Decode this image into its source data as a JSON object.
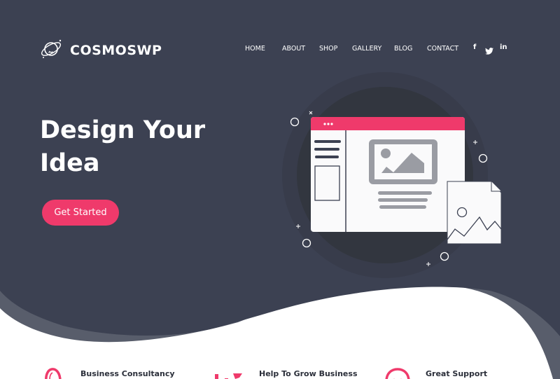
{
  "brand": {
    "name": "COSMOSWP",
    "logo_icon": "planet-icon"
  },
  "nav": {
    "items": [
      {
        "label": "HOME"
      },
      {
        "label": "ABOUT"
      },
      {
        "label": "SHOP"
      },
      {
        "label": "GALLERY"
      },
      {
        "label": "BLOG"
      },
      {
        "label": "CONTACT"
      }
    ],
    "social": [
      {
        "icon": "facebook-icon",
        "glyph": "f"
      },
      {
        "icon": "twitter-icon",
        "glyph": "🐦"
      },
      {
        "icon": "linkedin-icon",
        "glyph": "in"
      }
    ]
  },
  "hero": {
    "headline_line1": "Design Your",
    "headline_line2": "Idea",
    "cta_label": "Get Started",
    "illustration": "browser-window-with-image-illustration"
  },
  "features": [
    {
      "title": "Business Consultancy",
      "icon": "lightbulb-icon"
    },
    {
      "title": "Help To Grow Business",
      "icon": "growth-chart-icon"
    },
    {
      "title": "Great Support",
      "icon": "smiley-support-icon"
    }
  ],
  "colors": {
    "hero_bg": "#3c4152",
    "wave_secondary": "#585d6b",
    "accent": "#ef3a6b",
    "circle_outer": "#383c4b",
    "circle_inner": "#32363f",
    "text_dark": "#2b2f3a"
  }
}
